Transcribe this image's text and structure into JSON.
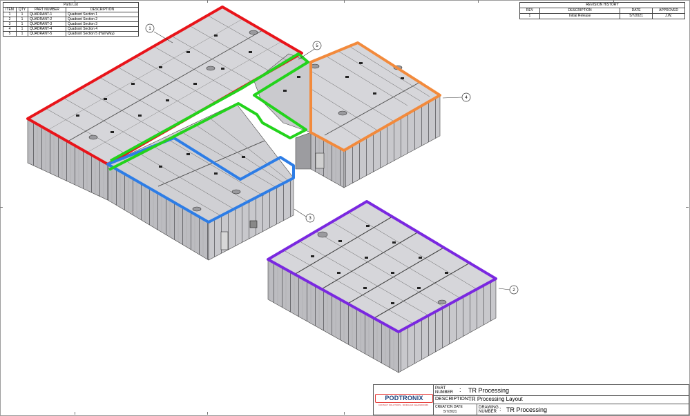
{
  "parts_list": {
    "title": "Parts List",
    "headers": [
      "ITEM",
      "QTY",
      "PART NUMBER",
      "DESCRIPTION"
    ],
    "rows": [
      [
        "1",
        "1",
        "QUADRANT-1",
        "Quadrant Section 1"
      ],
      [
        "2",
        "1",
        "QUADRANT-2",
        "Quadrant Section 2"
      ],
      [
        "3",
        "1",
        "QUADRANT-3",
        "Quadrant Section 3"
      ],
      [
        "4",
        "1",
        "QUADRANT-4",
        "Quadrant Section 4"
      ],
      [
        "5",
        "1",
        "QUADRANT-5",
        "Quadrant Section 5 (Hall Way)"
      ]
    ]
  },
  "revision_history": {
    "title": "REVISION HISTORY",
    "headers": [
      "REV",
      "DESCRIPTION",
      "DATE",
      "APPROVED"
    ],
    "rows": [
      [
        "1",
        "Initial Release",
        "5/7/2021",
        "J.W."
      ]
    ]
  },
  "balloons": [
    "1",
    "2",
    "3",
    "4",
    "5"
  ],
  "outline_colors": {
    "quadrant_1": "#e8141a",
    "quadrant_2": "#7a28e0",
    "quadrant_3": "#2d7de6",
    "quadrant_4": "#f28a3c",
    "quadrant_5": "#23d31c"
  },
  "title_block": {
    "logo": "PODTRONIX",
    "logo_tagline": "CONTACT SOLUTIONS · MODULAR CLEANROOMS",
    "part_number_label_1": "PART",
    "part_number_label_2": "NUMBER",
    "part_number": "TR Processing",
    "description_label": "DESCRIPTION:",
    "description": "TR Processing Layout",
    "creation_date_label": "CREATION DATE",
    "creation_date": "5/7/2021",
    "drawing_number_label_1": "DRAWING",
    "drawing_number_label_2": "NUMBER",
    "drawing_number": "TR Processing",
    "separator": ":"
  }
}
